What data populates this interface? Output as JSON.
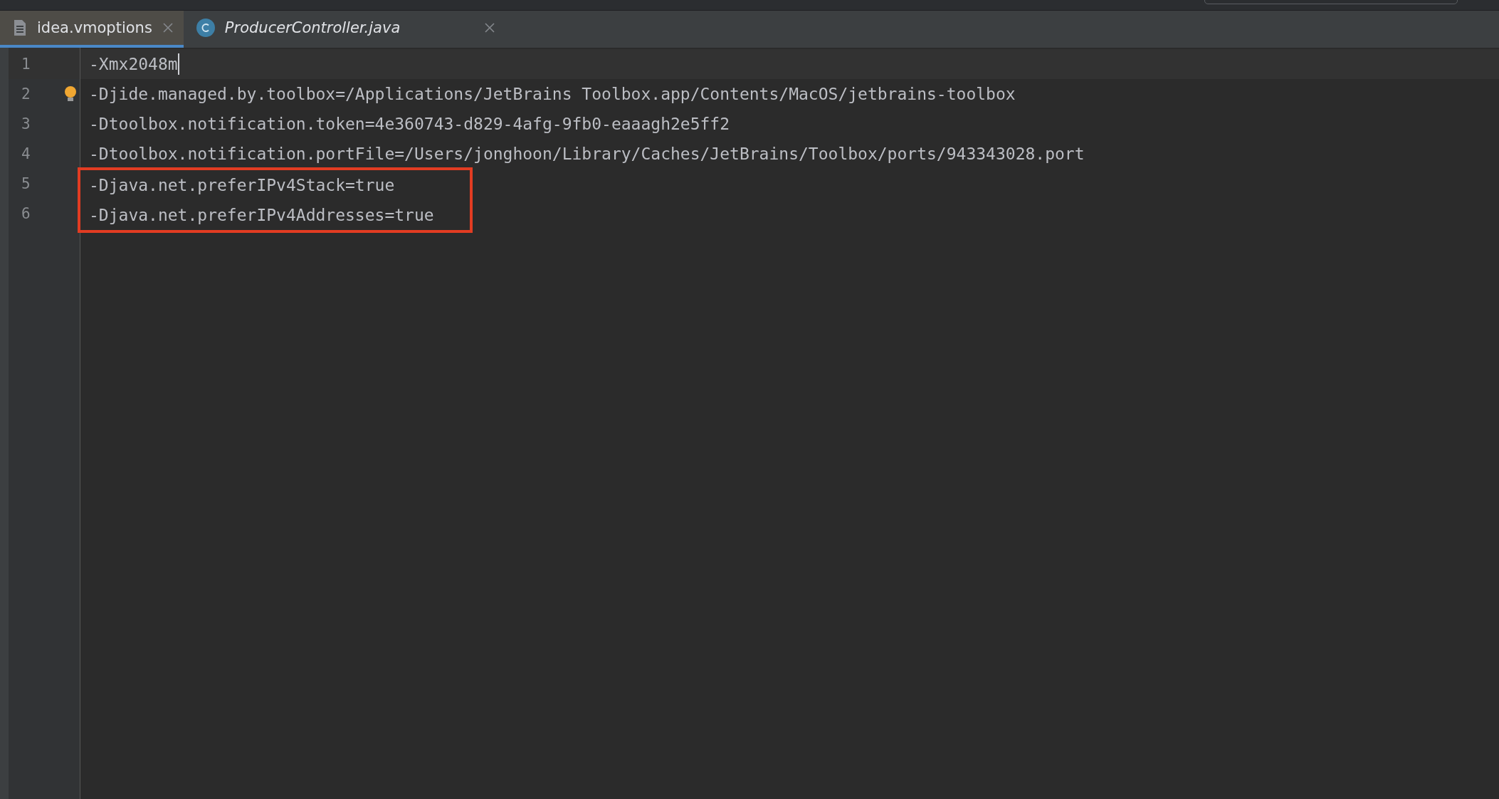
{
  "tabs": [
    {
      "label": "idea.vmoptions",
      "kind": "text",
      "selected": true
    },
    {
      "label": "ProducerController.java",
      "kind": "class",
      "selected": false
    }
  ],
  "lines": [
    {
      "number": "1",
      "text": "-Xmx2048m",
      "current": true,
      "boxed": false,
      "bulb": false
    },
    {
      "number": "2",
      "text": "-Djide.managed.by.toolbox=/Applications/JetBrains Toolbox.app/Contents/MacOS/jetbrains-toolbox",
      "current": false,
      "boxed": false,
      "bulb": true
    },
    {
      "number": "3",
      "text": "-Dtoolbox.notification.token=4e360743-d829-4afg-9fb0-eaaagh2e5ff2",
      "current": false,
      "boxed": false,
      "bulb": false
    },
    {
      "number": "4",
      "text": "-Dtoolbox.notification.portFile=/Users/jonghoon/Library/Caches/JetBrains/Toolbox/ports/943343028.port",
      "current": false,
      "boxed": false,
      "bulb": false
    },
    {
      "number": "5",
      "text": "-Djava.net.preferIPv4Stack=true",
      "current": false,
      "boxed": true,
      "bulb": false
    },
    {
      "number": "6",
      "text": "-Djava.net.preferIPv4Addresses=true",
      "current": false,
      "boxed": true,
      "bulb": false
    }
  ]
}
